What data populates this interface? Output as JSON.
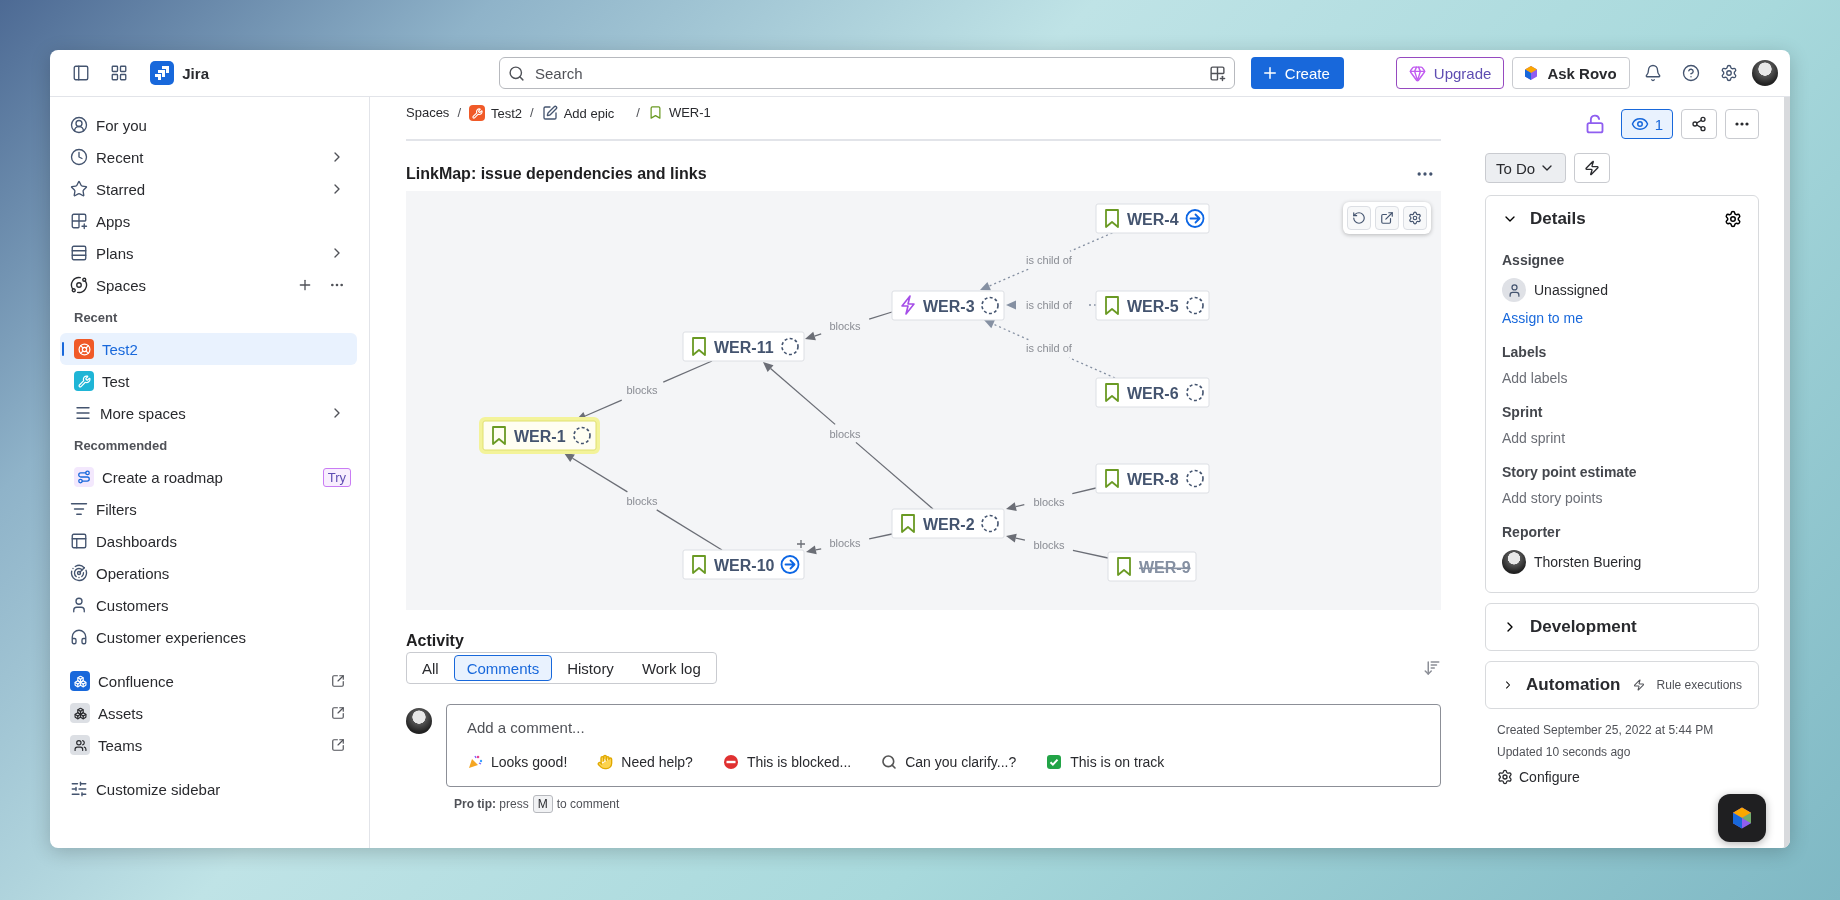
{
  "topbar": {
    "product": "Jira",
    "search_placeholder": "Search",
    "create": "Create",
    "upgrade": "Upgrade",
    "ask": "Ask Rovo"
  },
  "sidebar": {
    "groups": [
      [
        {
          "kind": "nav",
          "label": "For you",
          "chevron": false
        },
        {
          "kind": "nav",
          "label": "Recent",
          "chevron": true
        },
        {
          "kind": "nav",
          "label": "Starred",
          "chevron": true
        },
        {
          "kind": "nav",
          "label": "Apps",
          "chevron": false
        },
        {
          "kind": "nav",
          "label": "Plans",
          "chevron": true
        },
        {
          "kind": "section",
          "label": "Spaces"
        },
        {
          "kind": "heading",
          "label": "Recent"
        },
        {
          "kind": "space",
          "label": "Test2",
          "selected": true,
          "color": "#f05a28"
        },
        {
          "kind": "space",
          "label": "Test",
          "selected": false,
          "color": "#1fb5d6"
        },
        {
          "kind": "sub",
          "label": "More spaces",
          "chevron": true
        },
        {
          "kind": "heading",
          "label": "Recommended"
        },
        {
          "kind": "sub",
          "label": "Create a roadmap",
          "chevron": false,
          "badge": "Try"
        },
        {
          "kind": "nav",
          "label": "Filters",
          "chevron": false
        },
        {
          "kind": "nav",
          "label": "Dashboards",
          "chevron": false
        },
        {
          "kind": "nav",
          "label": "Operations",
          "chevron": false
        },
        {
          "kind": "nav",
          "label": "Customers",
          "chevron": false
        },
        {
          "kind": "nav",
          "label": "Customer experiences",
          "chevron": false
        }
      ],
      [
        {
          "kind": "app",
          "label": "Confluence"
        },
        {
          "kind": "app",
          "label": "Assets"
        },
        {
          "kind": "app",
          "label": "Teams"
        }
      ],
      [
        {
          "kind": "nav",
          "label": "Customize sidebar",
          "chevron": false
        }
      ]
    ]
  },
  "breadcrumb": {
    "separator": "/",
    "items": [
      {
        "kind": "text",
        "label": "Spaces"
      },
      {
        "kind": "space",
        "label": "Test2"
      },
      {
        "kind": "edit",
        "label": "Add epic"
      },
      {
        "kind": "issue",
        "label": "WER-1"
      }
    ]
  },
  "linkmap": {
    "title": "LinkMap: issue dependencies and links",
    "nodes": [
      {
        "label": "WER-4",
        "kind": "story",
        "linked": true,
        "done": false,
        "highlighted": false
      },
      {
        "label": "WER-3",
        "kind": "epic",
        "linked": false,
        "done": false,
        "highlighted": false
      },
      {
        "label": "WER-5",
        "kind": "story",
        "linked": false,
        "done": false,
        "highlighted": false
      },
      {
        "label": "WER-11",
        "kind": "story",
        "linked": false,
        "done": false,
        "highlighted": false
      },
      {
        "label": "WER-6",
        "kind": "story",
        "linked": false,
        "done": false,
        "highlighted": false
      },
      {
        "label": "WER-1",
        "kind": "story",
        "linked": false,
        "done": false,
        "highlighted": true
      },
      {
        "label": "WER-8",
        "kind": "story",
        "linked": false,
        "done": false,
        "highlighted": false
      },
      {
        "label": "WER-2",
        "kind": "story",
        "linked": false,
        "done": false,
        "highlighted": false
      },
      {
        "label": "WER-10",
        "kind": "story",
        "linked": true,
        "done": false,
        "highlighted": false
      },
      {
        "label": "WER-9",
        "kind": "story",
        "linked": false,
        "done": true,
        "highlighted": false
      }
    ],
    "links": [
      {
        "label": "is child of",
        "kind": "hierarchy"
      },
      {
        "label": "is child of",
        "kind": "hierarchy"
      },
      {
        "label": "is child of",
        "kind": "hierarchy"
      },
      {
        "label": "blocks",
        "kind": "dependency"
      },
      {
        "label": "blocks",
        "kind": "dependency"
      },
      {
        "label": "blocks",
        "kind": "dependency"
      },
      {
        "label": "blocks",
        "kind": "dependency"
      },
      {
        "label": "blocks",
        "kind": "dependency"
      },
      {
        "label": "blocks",
        "kind": "dependency"
      },
      {
        "label": "blocks",
        "kind": "dependency"
      }
    ]
  },
  "activity": {
    "title": "Activity",
    "tabs": [
      {
        "label": "All",
        "selected": false
      },
      {
        "label": "Comments",
        "selected": true
      },
      {
        "label": "History",
        "selected": false
      },
      {
        "label": "Work log",
        "selected": false
      }
    ],
    "comment_placeholder": "Add a comment...",
    "quick_replies": [
      "Looks good!",
      "Need help?",
      "This is blocked...",
      "Can you clarify...?",
      "This is on track"
    ],
    "pro_tip": {
      "before": "**Pro tip:** press",
      "key": "M",
      "after": "to comment"
    }
  },
  "issue_panel": {
    "watchers": "1",
    "status": "To Do",
    "details": {
      "title": "Details",
      "expanded": true,
      "fields": [
        {
          "label": "Assignee",
          "kind": "unassigned",
          "value": "Unassigned",
          "action": "Assign to me"
        },
        {
          "label": "Labels",
          "kind": "empty",
          "value": "Add labels"
        },
        {
          "label": "Sprint",
          "kind": "empty",
          "value": "Add sprint"
        },
        {
          "label": "Story point estimate",
          "kind": "empty",
          "value": "Add story points"
        },
        {
          "label": "Reporter",
          "kind": "person",
          "value": "Thorsten Buering"
        }
      ]
    },
    "panels": [
      {
        "title": "Development",
        "expanded": false
      },
      {
        "title": "Automation",
        "expanded": false,
        "note": "Rule executions"
      }
    ],
    "created": "Created September 25, 2022 at 5:44 PM",
    "updated": "Updated 10 seconds ago",
    "configure": "Configure"
  }
}
